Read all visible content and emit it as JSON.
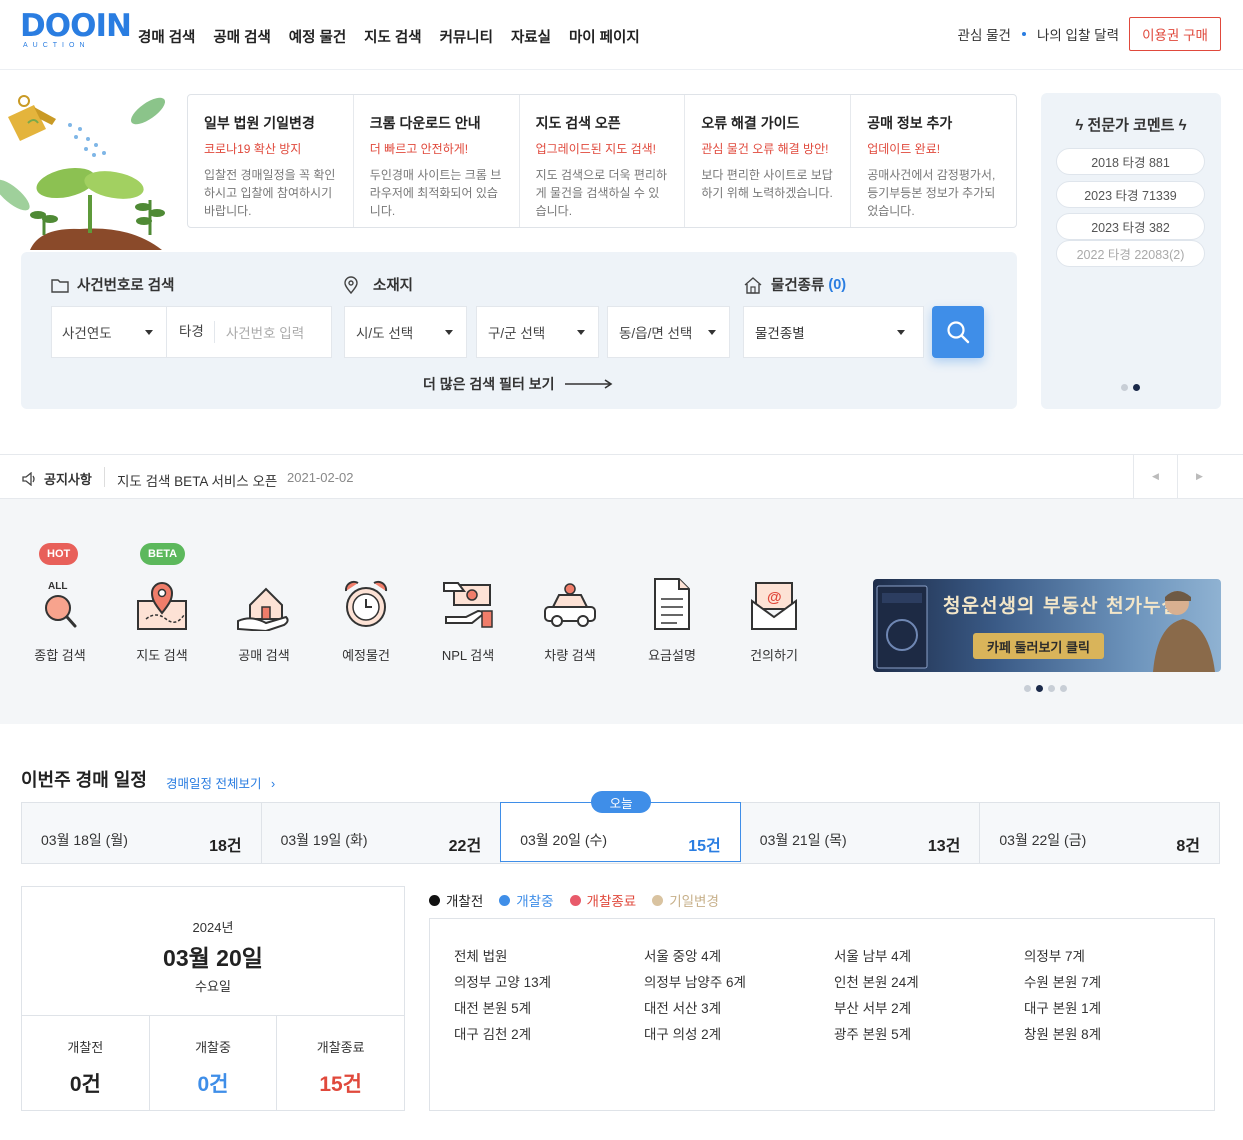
{
  "header": {
    "logo_text": "DOOIN",
    "logo_sub": "AUCTION",
    "nav": [
      "경매 검색",
      "공매 검색",
      "예정 물건",
      "지도 검색",
      "커뮤니티",
      "자료실",
      "마이 페이지"
    ],
    "links": [
      "관심 물건",
      "나의 입찰 달력"
    ],
    "buy_button": "이용권 구매",
    "colors": {
      "brand": "#2a7de1",
      "accent_red": "#e0493c"
    }
  },
  "notices": [
    {
      "title": "일부 법원 기일변경",
      "sub": "코로나19 확산 방지",
      "body": "입찰전 경매일정을 꼭 확인하시고 입찰에 참여하시기 바랍니다."
    },
    {
      "title": "크롬 다운로드 안내",
      "sub": "더 빠르고 안전하게!",
      "body": "두인경매 사이트는 크롬 브라우저에 최적화되어 있습니다."
    },
    {
      "title": "지도 검색 오픈",
      "sub": "업그레이드된 지도 검색!",
      "body": "지도 검색으로 더욱 편리하게 물건을 검색하실 수 있습니다."
    },
    {
      "title": "오류 해결 가이드",
      "sub": "관심 물건 오류 해결 방안!",
      "body": "보다 편리한 사이트로 보답하기 위해 노력하겠습니다."
    },
    {
      "title": "공매 정보 추가",
      "sub": "업데이트 완료!",
      "body": "공매사건에서 감정평가서, 등기부등본 정보가 추가되었습니다."
    }
  ],
  "search": {
    "case_label": "사건번호로 검색",
    "location_label": "소재지",
    "type_label": "물건종류",
    "type_count": "(0)",
    "year_select": "사건연도",
    "case_prefix": "타경",
    "case_placeholder": "사건번호 입력",
    "sido": "시/도 선택",
    "gugun": "구/군 선택",
    "dong": "동/읍/면 선택",
    "kind": "물건종별",
    "more_filter": "더 많은 검색 필터 보기"
  },
  "expert": {
    "title": "전문가 코멘트",
    "items": [
      "2018 타경 881",
      "2023 타경 71339",
      "2023 타경 382",
      "2022 타경 22083(2)"
    ]
  },
  "notice_bar": {
    "label": "공지사항",
    "text": "지도 검색 BETA 서비스 오픈",
    "date": "2021-02-02"
  },
  "quick_menu": {
    "items": [
      {
        "label": "종합 검색",
        "icon": "all-search-icon",
        "badge": "HOT"
      },
      {
        "label": "지도 검색",
        "icon": "map-pin-icon",
        "badge": "BETA"
      },
      {
        "label": "공매 검색",
        "icon": "house-hand-icon"
      },
      {
        "label": "예정물건",
        "icon": "alarm-clock-icon"
      },
      {
        "label": "NPL 검색",
        "icon": "money-hand-icon"
      },
      {
        "label": "차량 검색",
        "icon": "car-icon"
      },
      {
        "label": "요금설명",
        "icon": "document-icon"
      },
      {
        "label": "건의하기",
        "icon": "mail-icon"
      }
    ],
    "all_tag": "ALL",
    "banner_title": "청운선생의 부동산 천가누설",
    "banner_button": "카페 둘러보기 클릭"
  },
  "schedule": {
    "title": "이번주 경매 일정",
    "link": "경매일정 전체보기",
    "today_tag": "오늘",
    "days": [
      {
        "label": "03월 18일 (월)",
        "count": "18건"
      },
      {
        "label": "03월 19일 (화)",
        "count": "22건"
      },
      {
        "label": "03월 20일 (수)",
        "count": "15건"
      },
      {
        "label": "03월 21일 (목)",
        "count": "13건"
      },
      {
        "label": "03월 22일 (금)",
        "count": "8건"
      }
    ],
    "date_box": {
      "year": "2024년",
      "date": "03월 20일",
      "weekday": "수요일",
      "stats": [
        {
          "label": "개찰전",
          "value": "0건",
          "color": "#222222"
        },
        {
          "label": "개찰중",
          "value": "0건",
          "color": "#3f8ee8"
        },
        {
          "label": "개찰종료",
          "value": "15건",
          "color": "#e0493c"
        }
      ]
    },
    "legend": [
      {
        "label": "개찰전",
        "color": "#111111"
      },
      {
        "label": "개찰중",
        "color": "#3f8ee8"
      },
      {
        "label": "개찰종료",
        "color": "#e85a6a"
      },
      {
        "label": "기일변경",
        "color": "#d9c3a0"
      }
    ],
    "courts": [
      "전체 법원",
      "서울 중앙 4계",
      "서울 남부 4계",
      "의정부 7계",
      "의정부 고양 13계",
      "의정부 남양주 6계",
      "인천 본원 24계",
      "수원 본원 7계",
      "대전 본원 5계",
      "대전 서산 3계",
      "부산 서부 2계",
      "대구 본원 1계",
      "대구 김천 2계",
      "대구 의성 2계",
      "광주 본원 5계",
      "창원 본원 8계"
    ]
  }
}
